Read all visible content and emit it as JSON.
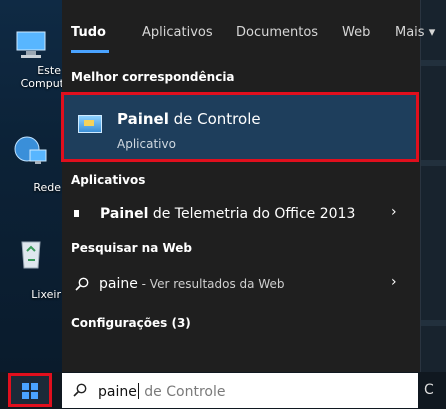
{
  "desktop": {
    "icons": [
      {
        "label_line1": "Este",
        "label_line2": "Comput",
        "icon": "this-pc-icon"
      },
      {
        "label": "Rede",
        "icon": "network-icon"
      },
      {
        "label": "Lixeir",
        "icon": "recycle-bin-icon"
      }
    ]
  },
  "tabs": [
    {
      "label": "Tudo",
      "active": true
    },
    {
      "label": "Aplicativos"
    },
    {
      "label": "Documentos"
    },
    {
      "label": "Web"
    },
    {
      "label": "Mais ▾"
    }
  ],
  "best_match": {
    "heading": "Melhor correspondência",
    "title_bold": "Painel",
    "title_rest": " de Controle",
    "subtitle": "Aplicativo",
    "icon": "control-panel-icon"
  },
  "apps_section": {
    "heading": "Aplicativos",
    "items": [
      {
        "bold": "Painel",
        "rest": " de Telemetria do Office 2013",
        "chevron": "›"
      }
    ]
  },
  "web_section": {
    "heading": "Pesquisar na Web",
    "items": [
      {
        "query": "paine",
        "suffix": " - Ver resultados da Web",
        "chevron": "›"
      }
    ]
  },
  "settings_section": {
    "heading": "Configurações (3)"
  },
  "taskbar": {
    "search_typed": "paine",
    "search_ghost": " de Controle",
    "right_glyph": "C"
  },
  "colors": {
    "accent": "#4aa3ff",
    "highlight_box": "#e10f1d",
    "selected_bg": "#1e3e5c"
  }
}
